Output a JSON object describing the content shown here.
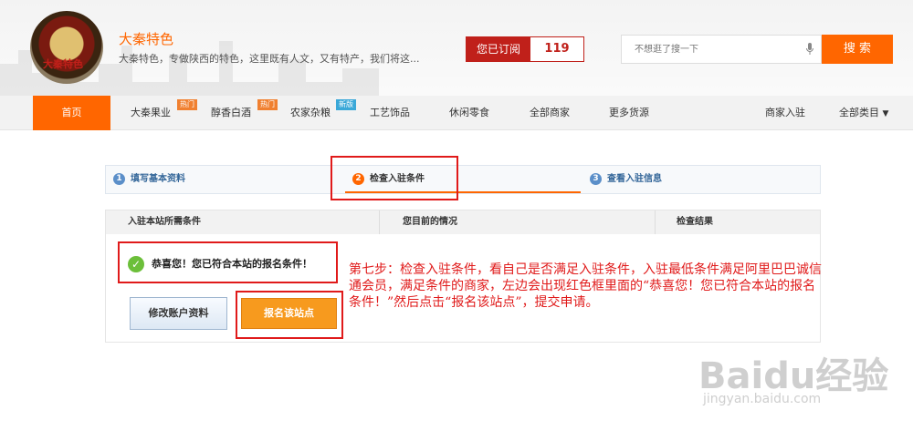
{
  "header": {
    "logo_text": "大秦特色",
    "shop_name": "大秦特色",
    "shop_desc": "大秦特色，专做陕西的特色，这里既有人文，又有特产，我们将这...",
    "subscribe_label": "您已订阅",
    "subscribe_count": "119",
    "search_placeholder": "不想逛了搜一下",
    "search_button": "搜 索"
  },
  "nav": {
    "home": "首页",
    "items": [
      "大秦果业",
      "醇香白酒",
      "农家杂粮",
      "工艺饰品",
      "休闲零食",
      "全部商家",
      "更多货源"
    ],
    "badges": {
      "hot1": "热门",
      "hot2": "热门",
      "new": "新版"
    },
    "merchant": "商家入驻",
    "all_categories": "全部类目"
  },
  "steps": [
    {
      "num": "1",
      "label": "填写基本资料"
    },
    {
      "num": "2",
      "label": "检查入驻条件"
    },
    {
      "num": "3",
      "label": "查看入驻信息"
    }
  ],
  "colors": {
    "step1": "#5b8fc9",
    "step2": "#ff6600",
    "step3": "#5b8fc9"
  },
  "table": {
    "col1": "入驻本站所需条件",
    "col2": "您目前的情况",
    "col3": "检查结果"
  },
  "result": {
    "success_text": "恭喜您！您已符合本站的报名条件！",
    "edit_button": "修改账户资料",
    "apply_button": "报名该站点"
  },
  "note": "第七步：检查入驻条件，看自己是否满足入驻条件，入驻最低条件满足阿里巴巴诚信通会员，满足条件的商家，左边会出现红色框里面的“恭喜您！您已符合本站的报名条件！”然后点击“报名该站点”，提交申请。",
  "watermark": {
    "brand": "Baidu经验",
    "url": "jingyan.baidu.com"
  }
}
